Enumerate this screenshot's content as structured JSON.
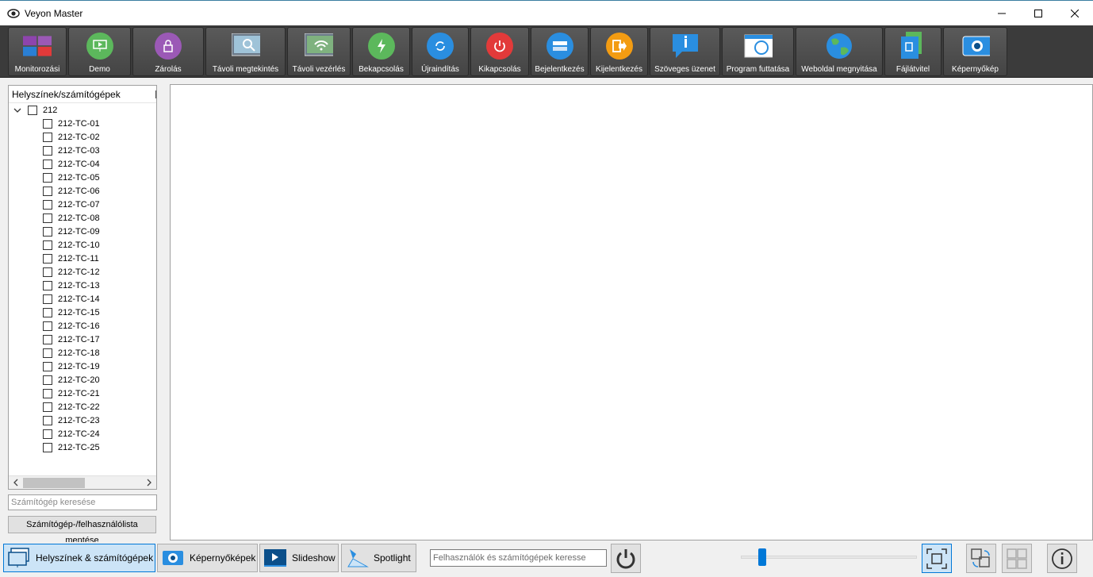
{
  "window": {
    "title": "Veyon Master"
  },
  "toolbar": {
    "buttons": [
      {
        "label": "Monitorozási",
        "icon": "monitor-grid-icon"
      },
      {
        "label": "Demo",
        "icon": "demo-icon"
      },
      {
        "label": "Zárolás",
        "icon": "lock-icon"
      },
      {
        "label": "Távoli megtekintés",
        "icon": "remote-view-icon"
      },
      {
        "label": "Távoli vezérlés",
        "icon": "remote-control-icon"
      },
      {
        "label": "Bekapcsolás",
        "icon": "power-on-icon"
      },
      {
        "label": "Újraindítás",
        "icon": "reboot-icon"
      },
      {
        "label": "Kikapcsolás",
        "icon": "power-down-icon"
      },
      {
        "label": "Bejelentkezés",
        "icon": "login-icon"
      },
      {
        "label": "Kijelentkezés",
        "icon": "logout-icon"
      },
      {
        "label": "Szöveges üzenet",
        "icon": "text-message-icon"
      },
      {
        "label": "Program futtatása",
        "icon": "run-program-icon"
      },
      {
        "label": "Weboldal megnyitása",
        "icon": "open-website-icon"
      },
      {
        "label": "Fájlátvitel",
        "icon": "file-transfer-icon"
      },
      {
        "label": "Képernyőkép",
        "icon": "screenshot-icon"
      }
    ]
  },
  "tree": {
    "header": "Helyszínek/számítógépek",
    "root": "212",
    "computers": [
      "212-TC-01",
      "212-TC-02",
      "212-TC-03",
      "212-TC-04",
      "212-TC-05",
      "212-TC-06",
      "212-TC-07",
      "212-TC-08",
      "212-TC-09",
      "212-TC-10",
      "212-TC-11",
      "212-TC-12",
      "212-TC-13",
      "212-TC-14",
      "212-TC-15",
      "212-TC-16",
      "212-TC-17",
      "212-TC-18",
      "212-TC-19",
      "212-TC-20",
      "212-TC-21",
      "212-TC-22",
      "212-TC-23",
      "212-TC-24",
      "212-TC-25"
    ]
  },
  "left": {
    "search_placeholder": "Számítógép keresése",
    "save_button": "Számítógép-/felhasználólista mentése"
  },
  "bottom": {
    "tabs": [
      {
        "label": "Helyszínek & számítógépek",
        "active": true
      },
      {
        "label": "Képernyőképek",
        "active": false
      },
      {
        "label": "Slideshow",
        "active": false
      },
      {
        "label": "Spotlight",
        "active": false
      }
    ],
    "search_placeholder": "Felhasználók és számítógépek keresse"
  },
  "colors": {
    "accent": "#0078d7",
    "toolbar": "#3b3b3b"
  }
}
